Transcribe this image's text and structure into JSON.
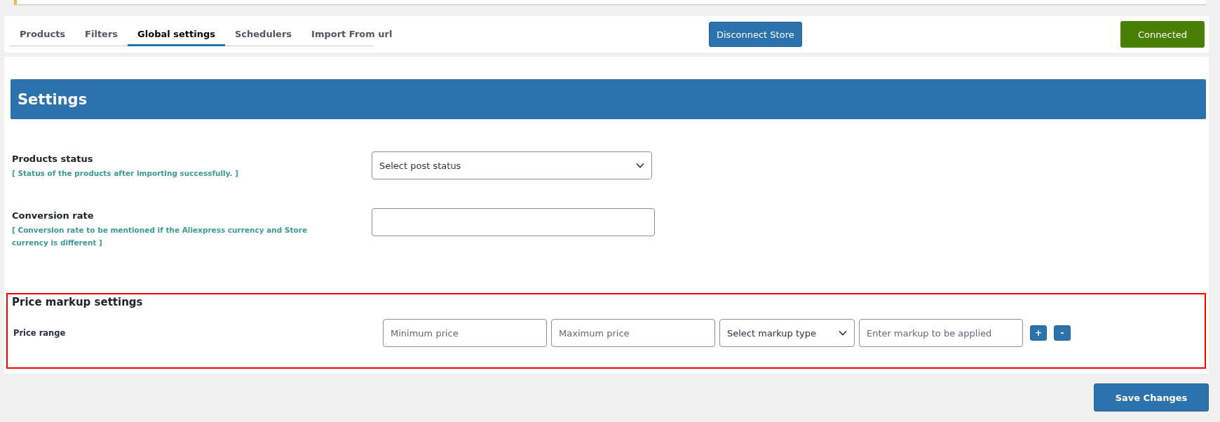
{
  "tabs": [
    {
      "label": "Products",
      "selected": false
    },
    {
      "label": "Filters",
      "selected": false
    },
    {
      "label": "Global settings",
      "selected": true
    },
    {
      "label": "Schedulers",
      "selected": false
    },
    {
      "label": "Import From url",
      "selected": false
    }
  ],
  "disconnect_button": "Disconnect Store",
  "status_button": "Connected",
  "settings": {
    "title": "Settings",
    "fields": [
      {
        "label": "Products status",
        "hint": "[ Status of the products after importing successfully. ]",
        "kind": "select",
        "value": "Select post status"
      },
      {
        "label": "Conversion rate",
        "hint": "[ Conversion rate to be mentioned if the Aliexpress currency and Store currency is different ]",
        "kind": "input"
      }
    ]
  },
  "price_markup": {
    "title": "Price markup settings",
    "row_label": "Price range",
    "controls": [
      {
        "kind": "input",
        "placeholder": "Minimum price"
      },
      {
        "kind": "input",
        "placeholder": "Maximum price"
      },
      {
        "kind": "select",
        "value": "Select markup type"
      },
      {
        "kind": "input",
        "placeholder": "Enter markup to be applied"
      }
    ],
    "add_button": "+",
    "remove_button": "-"
  },
  "save_button": "Save Changes"
}
